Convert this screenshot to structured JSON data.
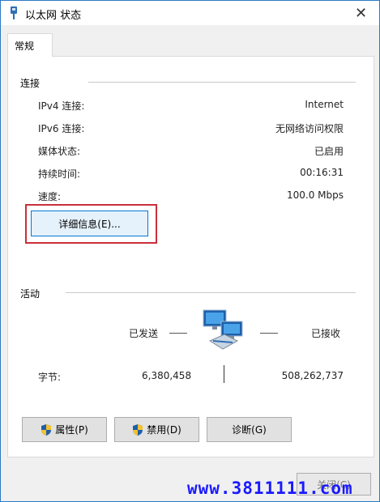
{
  "window": {
    "title": "以太网 状态",
    "close_glyph": "✕"
  },
  "tabs": [
    {
      "label": "常规"
    }
  ],
  "connection": {
    "section_title": "连接",
    "rows": [
      {
        "label": "IPv4 连接:",
        "value": "Internet"
      },
      {
        "label": "IPv6 连接:",
        "value": "无网络访问权限"
      },
      {
        "label": "媒体状态:",
        "value": "已启用"
      },
      {
        "label": "持续时间:",
        "value": "00:16:31"
      },
      {
        "label": "速度:",
        "value": "100.0 Mbps"
      }
    ],
    "details_button": "详细信息(E)..."
  },
  "activity": {
    "section_title": "活动",
    "sent_label": "已发送",
    "received_label": "已接收",
    "bytes_label": "字节:",
    "bytes_sent": "6,380,458",
    "bytes_received": "508,262,737"
  },
  "buttons": {
    "properties": "属性(P)",
    "disable": "禁用(D)",
    "diagnose": "诊断(G)",
    "close": "关闭(C)"
  },
  "watermark": "www.3811111.com",
  "colors": {
    "accent": "#0078d7",
    "highlight": "#c9303a",
    "watermark": "#1a1aff"
  },
  "icons": [
    "ethernet-status-icon",
    "close-icon",
    "network-computers-icon",
    "uac-shield-icon"
  ]
}
